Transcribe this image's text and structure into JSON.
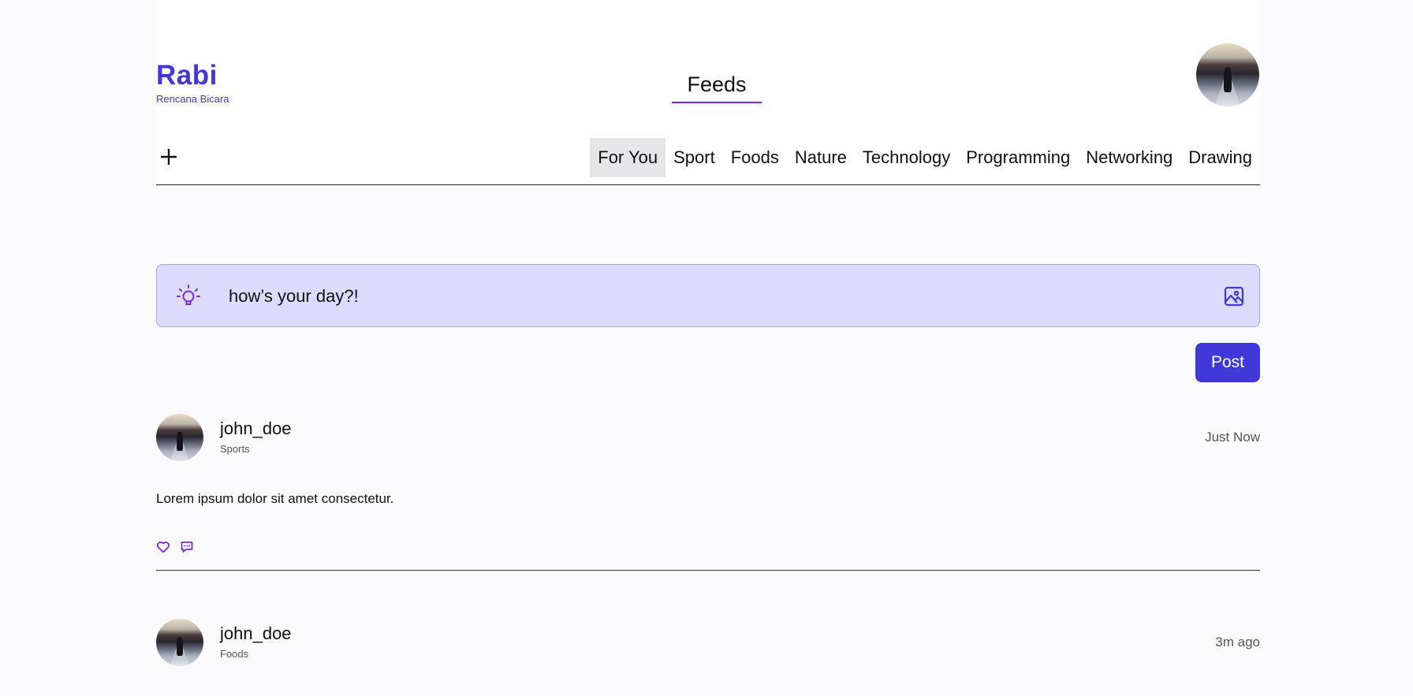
{
  "brand": {
    "name": "Rabi",
    "tagline": "Rencana Bicara"
  },
  "page_title": "Feeds",
  "tabs": [
    {
      "label": "For You",
      "active": true
    },
    {
      "label": "Sport",
      "active": false
    },
    {
      "label": "Foods",
      "active": false
    },
    {
      "label": "Nature",
      "active": false
    },
    {
      "label": "Technology",
      "active": false
    },
    {
      "label": "Programming",
      "active": false
    },
    {
      "label": "Networking",
      "active": false
    },
    {
      "label": "Drawing",
      "active": false
    }
  ],
  "composer": {
    "text": "how’s your day?!",
    "post_label": "Post"
  },
  "posts": [
    {
      "user": "john_doe",
      "category": "Sports",
      "time": "Just Now",
      "body": "Lorem ipsum dolor sit amet consectetur."
    },
    {
      "user": "john_doe",
      "category": "Foods",
      "time": "3m ago"
    }
  ],
  "icons": {
    "add": "plus-icon",
    "composer": "lightbulb-icon",
    "attach": "image-icon",
    "like": "heart-icon",
    "comment": "comment-icon"
  },
  "colors": {
    "brand": "#4438d4",
    "accent": "#7c2ad6",
    "composer_bg": "#dcdbfb",
    "button": "#4038d8"
  }
}
